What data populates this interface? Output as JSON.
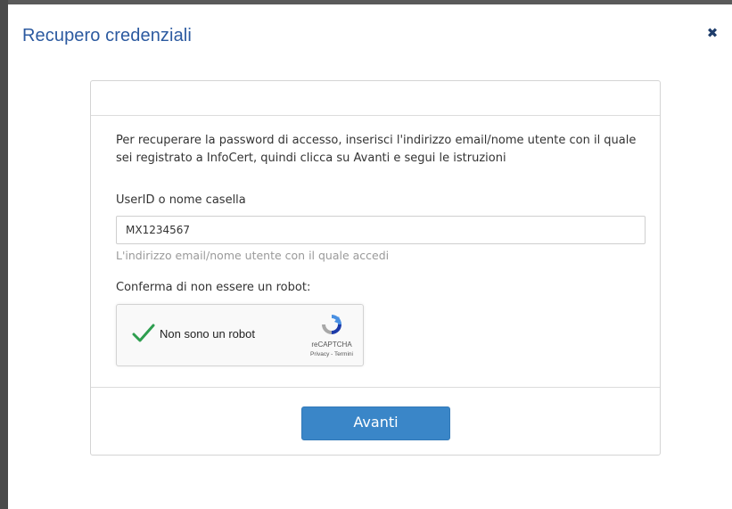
{
  "dialog": {
    "title": "Recupero credenziali",
    "close_icon": "close-icon"
  },
  "form": {
    "intro": "Per recuperare la password di accesso, inserisci l'indirizzo email/nome utente con il quale sei registrato a InfoCert, quindi clicca su Avanti e segui le istruzioni",
    "userid_label": "UserID o nome casella",
    "userid_value": "MX1234567",
    "userid_help": "L'indirizzo email/nome utente con il quale accedi",
    "robot_label": "Conferma di non essere un robot:",
    "submit_label": "Avanti"
  },
  "recaptcha": {
    "label": "Non sono un robot",
    "checked": true,
    "brand": "reCAPTCHA",
    "links": "Privacy - Termini",
    "check_color": "#2e9e4f"
  },
  "colors": {
    "title": "#2c5aa0",
    "button": "#3a86c8"
  }
}
